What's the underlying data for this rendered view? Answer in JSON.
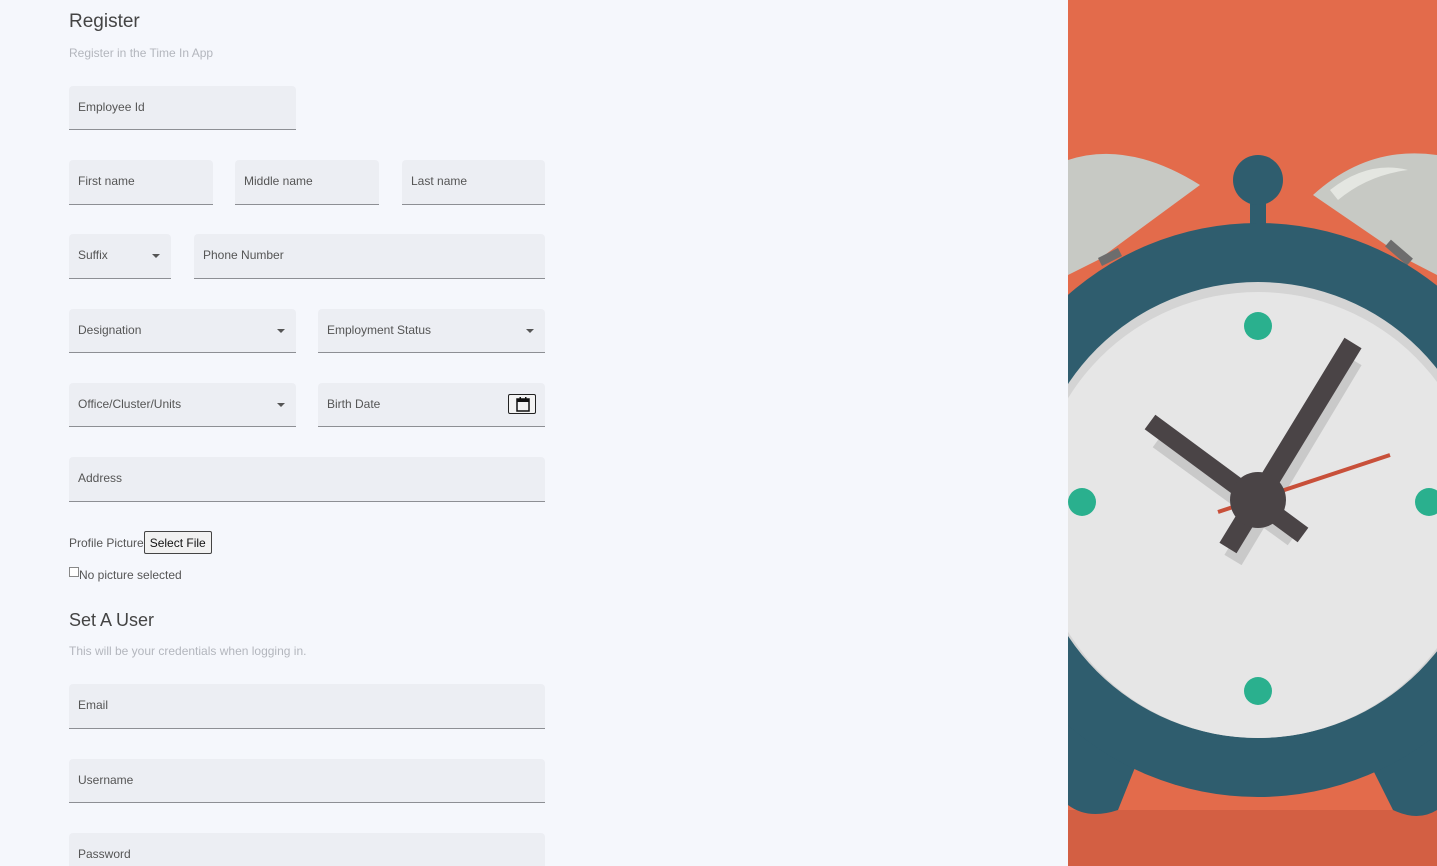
{
  "register": {
    "title": "Register",
    "subtitle": "Register in the Time In App"
  },
  "fields": {
    "employee_id": "Employee Id",
    "first_name": "First name",
    "middle_name": "Middle name",
    "last_name": "Last name",
    "suffix": "Suffix",
    "phone_number": "Phone Number",
    "designation": "Designation",
    "employment_status": "Employment Status",
    "office": "Office/Cluster/Units",
    "birth_date": "Birth Date",
    "address": "Address"
  },
  "profile_picture": {
    "label": "Profile Picture",
    "button": "Select File",
    "status": "No picture selected"
  },
  "user": {
    "title": "Set A User",
    "subtitle": "This will be your credentials when logging in.",
    "email": "Email",
    "username": "Username",
    "password": "Password"
  },
  "icons": {
    "dropdown": "caret-down-icon",
    "calendar": "calendar-icon"
  },
  "colors": {
    "page_bg": "#f5f7fc",
    "field_bg": "#eceef3",
    "art_bg": "#e36b4b",
    "clock_rim": "#2f5d6e",
    "clock_face": "#e6e6e6",
    "clock_marks": "#2ab08e",
    "second_hand": "#c8503a",
    "hands": "#4a4446"
  }
}
